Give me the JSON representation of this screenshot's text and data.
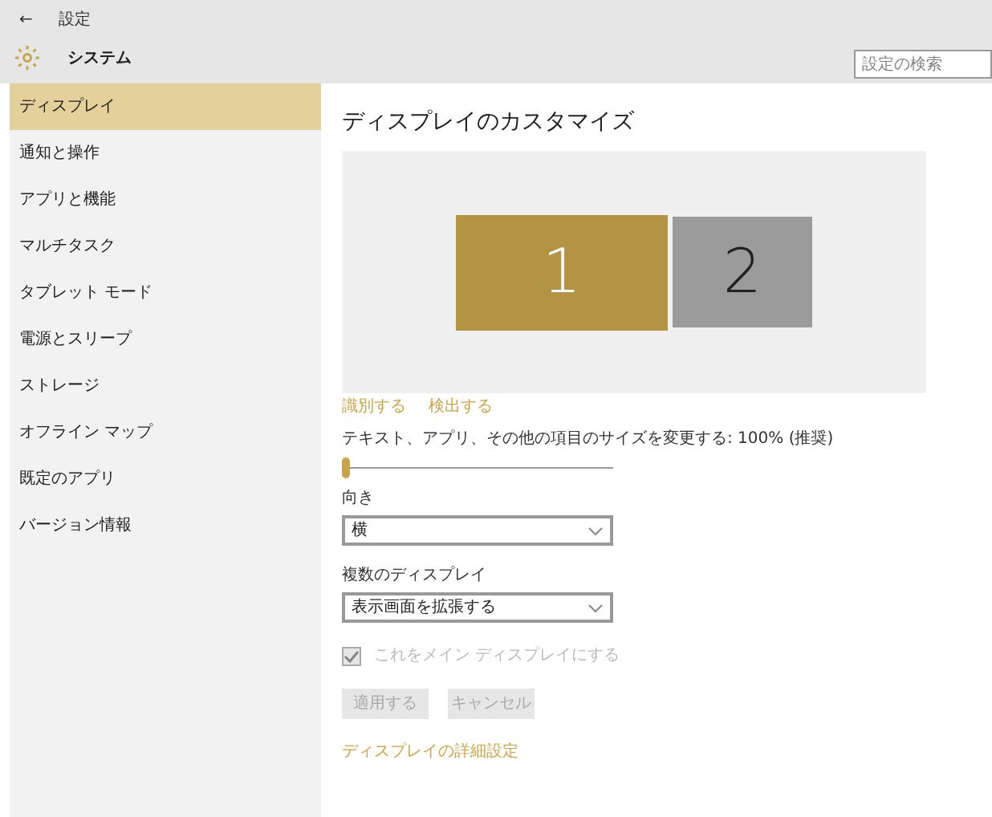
{
  "header": {
    "back": "←",
    "title": "設定",
    "section": "システム",
    "search": {
      "placeholder": "設定の検索"
    }
  },
  "sidebar": {
    "items": [
      {
        "label": "ディスプレイ",
        "selected": true
      },
      {
        "label": "通知と操作",
        "selected": false
      },
      {
        "label": "アプリと機能",
        "selected": false
      },
      {
        "label": "マルチタスク",
        "selected": false
      },
      {
        "label": "タブレット モード",
        "selected": false
      },
      {
        "label": "電源とスリープ",
        "selected": false
      },
      {
        "label": "ストレージ",
        "selected": false
      },
      {
        "label": "オフライン マップ",
        "selected": false
      },
      {
        "label": "既定のアプリ",
        "selected": false
      },
      {
        "label": "バージョン情報",
        "selected": false
      }
    ]
  },
  "main": {
    "title": "ディスプレイのカスタマイズ",
    "monitors": [
      {
        "label": "1",
        "selected": true
      },
      {
        "label": "2",
        "selected": false
      }
    ],
    "links": [
      "識別する",
      "検出する"
    ],
    "scale": {
      "label": "テキスト、アプリ、その他の項目のサイズを変更する: 100% (推奨)",
      "level": 0
    },
    "orientation": {
      "label": "向き",
      "value": "横"
    },
    "multiple": {
      "label": "複数のディスプレイ",
      "value": "表示画面を拡張する"
    },
    "main_display": {
      "label": "これをメイン ディスプレイにする",
      "checked": true,
      "disabled": true
    },
    "buttons": [
      {
        "label": "適用する",
        "disabled": true
      },
      {
        "label": "キャンセル",
        "disabled": true
      }
    ],
    "advanced_link": "ディスプレイの詳細設定"
  }
}
